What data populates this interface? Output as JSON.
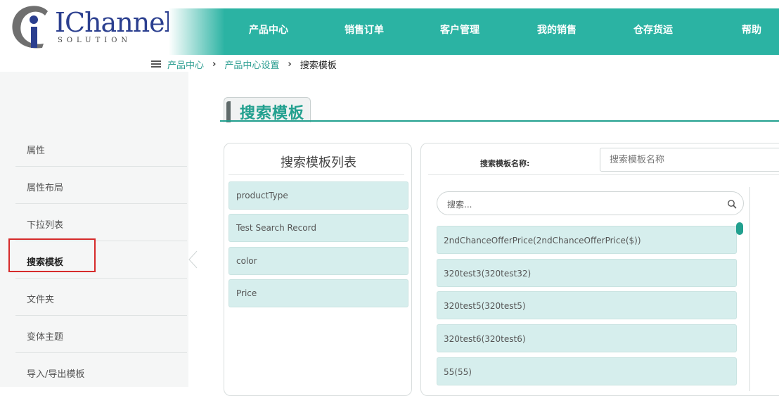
{
  "colors": {
    "accent": "#2bb3a3",
    "title_green": "#22a08f",
    "active_border": "#d62b2b",
    "item_bg": "#d6eeed"
  },
  "logo": {
    "brand": "IChannel",
    "sub": "SOLUTION",
    "icon": "ci-logo-icon"
  },
  "nav": {
    "items": [
      "产品中心",
      "销售订单",
      "客户管理",
      "我的销售",
      "仓存货运",
      "帮助"
    ]
  },
  "breadcrumb": {
    "menu_icon": "hamburger-icon",
    "items": [
      "产品中心",
      "产品中心设置",
      "搜索模板"
    ],
    "separator": "›"
  },
  "sidebar": {
    "items": [
      {
        "label": "属性"
      },
      {
        "label": "属性布局"
      },
      {
        "label": "下拉列表"
      },
      {
        "label": "搜索模板",
        "active": true
      },
      {
        "label": "文件夹"
      },
      {
        "label": "变体主题"
      },
      {
        "label": "导入/导出模板"
      }
    ]
  },
  "page": {
    "title": "搜索模板"
  },
  "template_list": {
    "title": "搜索模板列表",
    "items": [
      "productType",
      "Test Search Record",
      "color",
      "Price"
    ]
  },
  "template_form": {
    "name_label": "搜索模板名称:",
    "name_placeholder": "搜索模板名称",
    "search_placeholder": "搜索...",
    "fields": [
      "2ndChanceOfferPrice(2ndChanceOfferPrice($))",
      "320test3(320test32)",
      "320test5(320test5)",
      "320test6(320test6)",
      "55(55)"
    ]
  }
}
